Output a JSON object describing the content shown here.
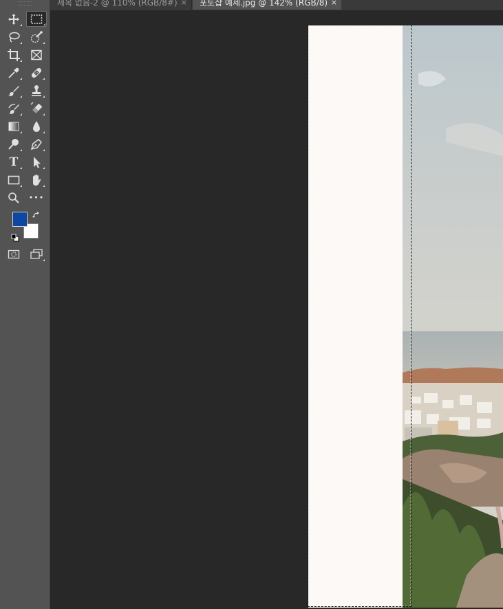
{
  "tabs": [
    {
      "label": "제목 없음-2 @ 110% (RGB/8#)",
      "close": "×",
      "active": false
    },
    {
      "label": "포토샵 예제.jpg @ 142% (RGB/8)",
      "close": "×",
      "active": true
    }
  ],
  "tools": [
    {
      "name": "move-tool",
      "icon": "move-icon"
    },
    {
      "name": "rectangular-marquee-tool",
      "icon": "marquee-icon",
      "active": true
    },
    {
      "name": "lasso-tool",
      "icon": "lasso-icon"
    },
    {
      "name": "quick-selection-tool",
      "icon": "quick-selection-icon"
    },
    {
      "name": "crop-tool",
      "icon": "crop-icon"
    },
    {
      "name": "frame-tool",
      "icon": "frame-icon"
    },
    {
      "name": "eyedropper-tool",
      "icon": "eyedropper-icon"
    },
    {
      "name": "healing-brush-tool",
      "icon": "bandage-icon"
    },
    {
      "name": "brush-tool",
      "icon": "brush-icon"
    },
    {
      "name": "clone-stamp-tool",
      "icon": "stamp-icon"
    },
    {
      "name": "history-brush-tool",
      "icon": "history-brush-icon"
    },
    {
      "name": "eraser-tool",
      "icon": "eraser-icon"
    },
    {
      "name": "gradient-tool",
      "icon": "gradient-icon"
    },
    {
      "name": "blur-tool",
      "icon": "drop-icon"
    },
    {
      "name": "dodge-tool",
      "icon": "dodge-icon"
    },
    {
      "name": "pen-tool",
      "icon": "pen-icon"
    },
    {
      "name": "type-tool",
      "icon": "type-icon",
      "glyph": "T"
    },
    {
      "name": "path-selection-tool",
      "icon": "arrow-icon"
    },
    {
      "name": "rectangle-tool",
      "icon": "rectangle-icon"
    },
    {
      "name": "hand-tool",
      "icon": "hand-icon"
    },
    {
      "name": "zoom-tool",
      "icon": "zoom-icon"
    },
    {
      "name": "edit-toolbar",
      "icon": "more-icon",
      "glyph": "•••"
    }
  ],
  "colors": {
    "foreground": "#0d47a1",
    "background": "#ffffff",
    "canvas_bg": "#282828",
    "panel_bg": "#535353",
    "selected_area_fill": "#fdf9f7"
  }
}
